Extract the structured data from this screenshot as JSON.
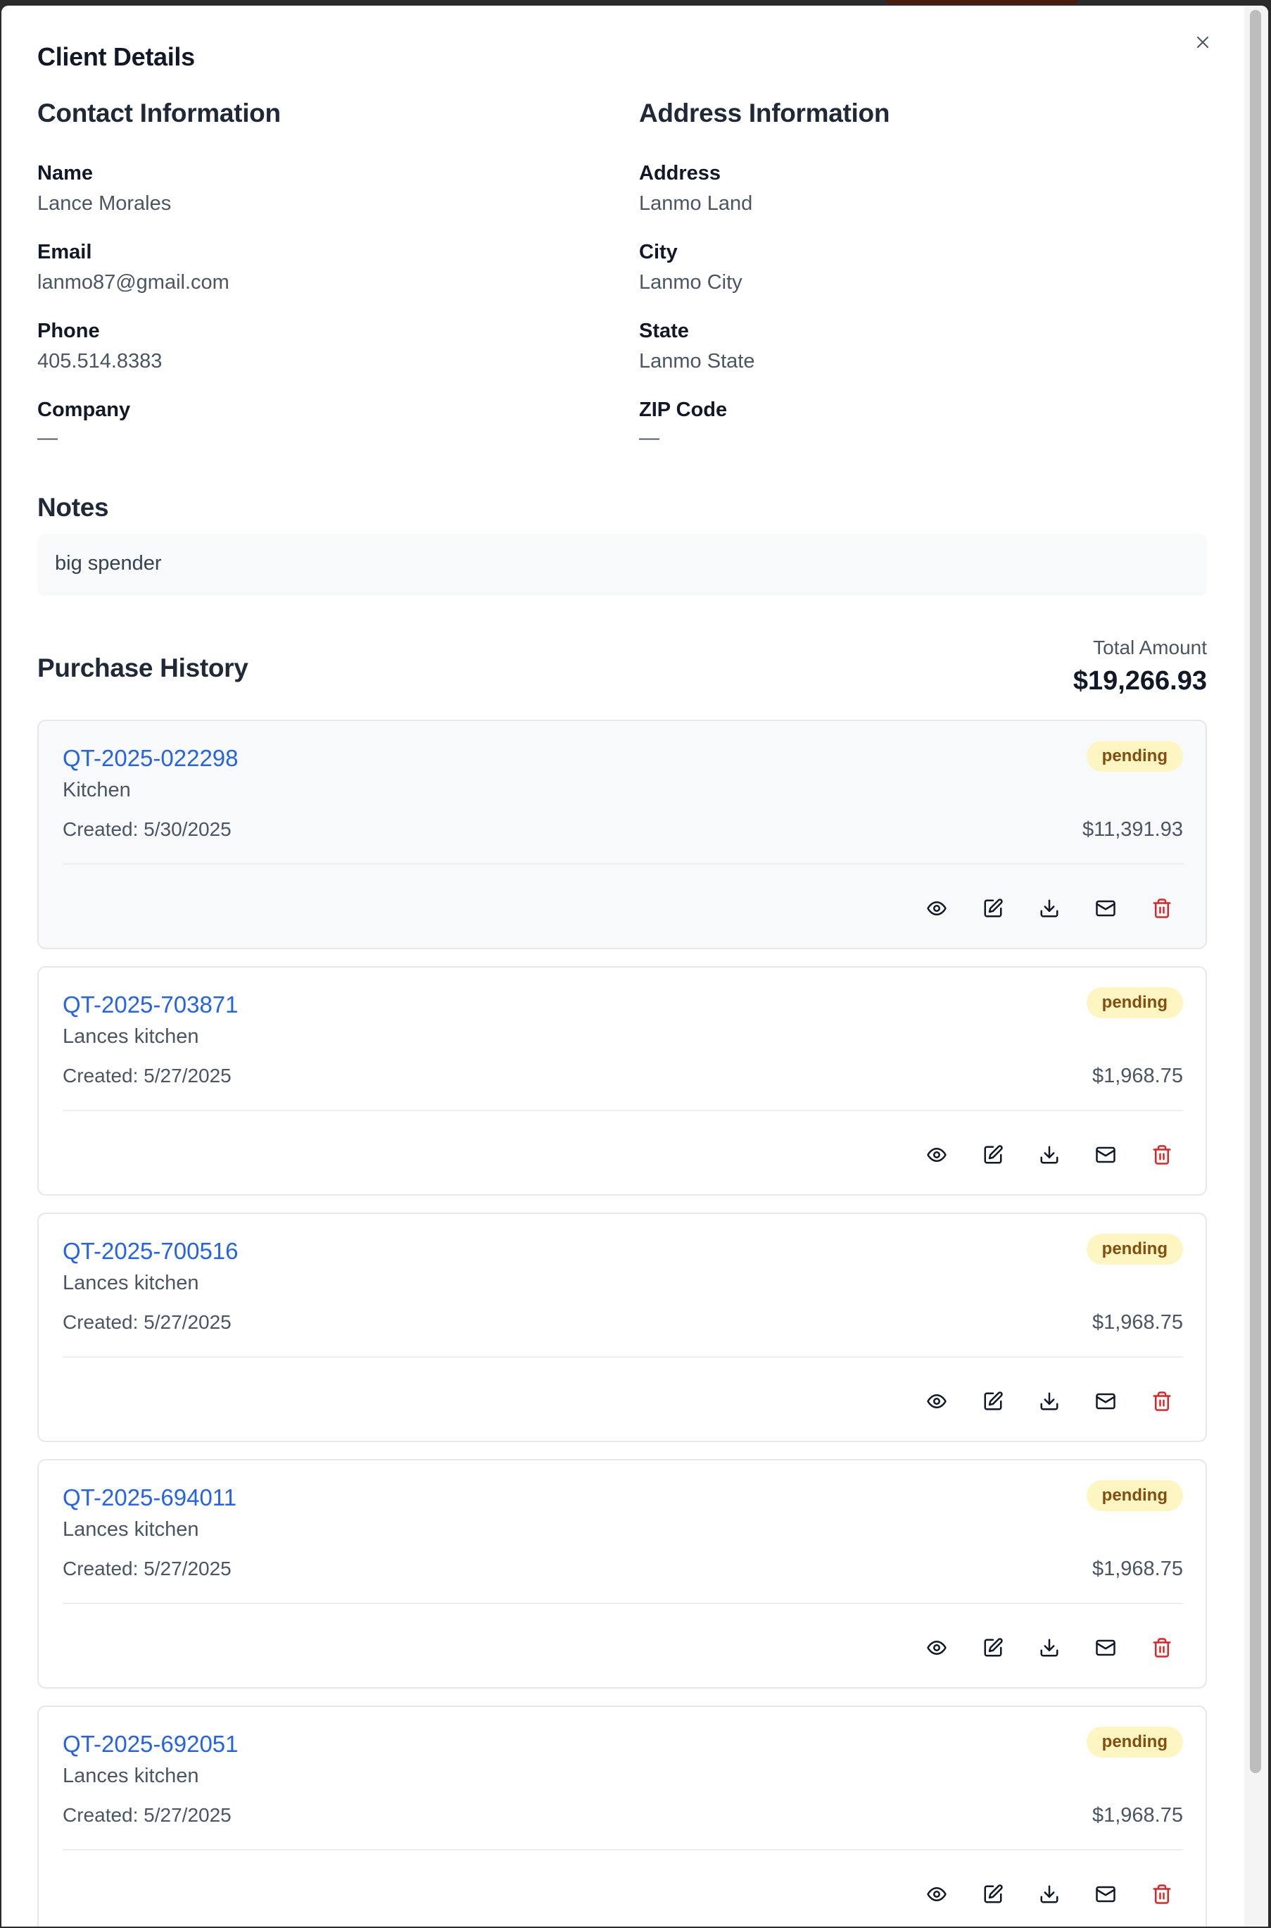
{
  "dialog": {
    "title": "Client Details",
    "close_icon": "close-icon"
  },
  "contact": {
    "heading": "Contact Information",
    "fields": [
      {
        "label": "Name",
        "value": "Lance Morales"
      },
      {
        "label": "Email",
        "value": "lanmo87@gmail.com"
      },
      {
        "label": "Phone",
        "value": "405.514.8383"
      },
      {
        "label": "Company",
        "value": "—"
      }
    ]
  },
  "address": {
    "heading": "Address Information",
    "fields": [
      {
        "label": "Address",
        "value": "Lanmo Land"
      },
      {
        "label": "City",
        "value": "Lanmo City"
      },
      {
        "label": "State",
        "value": "Lanmo State"
      },
      {
        "label": "ZIP Code",
        "value": "—"
      }
    ]
  },
  "notes": {
    "heading": "Notes",
    "text": "big spender"
  },
  "purchase_history": {
    "heading": "Purchase History",
    "total_label": "Total Amount",
    "total_amount": "$19,266.93",
    "quotes": [
      {
        "ref": "QT-2025-022298",
        "project": "Kitchen",
        "created": "Created: 5/30/2025",
        "amount": "$11,391.93",
        "status": "pending"
      },
      {
        "ref": "QT-2025-703871",
        "project": "Lances kitchen",
        "created": "Created: 5/27/2025",
        "amount": "$1,968.75",
        "status": "pending"
      },
      {
        "ref": "QT-2025-700516",
        "project": "Lances kitchen",
        "created": "Created: 5/27/2025",
        "amount": "$1,968.75",
        "status": "pending"
      },
      {
        "ref": "QT-2025-694011",
        "project": "Lances kitchen",
        "created": "Created: 5/27/2025",
        "amount": "$1,968.75",
        "status": "pending"
      },
      {
        "ref": "QT-2025-692051",
        "project": "Lances kitchen",
        "created": "Created: 5/27/2025",
        "amount": "$1,968.75",
        "status": "pending"
      }
    ],
    "action_icons": [
      "eye-icon",
      "edit-icon",
      "download-icon",
      "mail-icon",
      "trash-icon"
    ]
  },
  "colors": {
    "link": "#2563eb",
    "badge_bg": "#fdf6c3",
    "badge_text": "#854d0e",
    "delete": "#dc2626"
  }
}
